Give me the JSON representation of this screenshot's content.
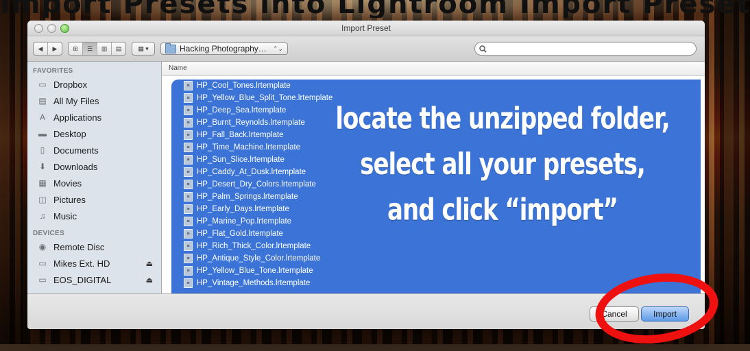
{
  "banner_text": "Import Presets into Lightroom Import Preset",
  "window": {
    "title": "Import Preset"
  },
  "toolbar": {
    "back_label": "◀",
    "forward_label": "▶",
    "view_icons": "⊞",
    "view_list": "☰",
    "view_columns": "▥",
    "view_coverflow": "▤",
    "arrange_label": "▦ ▾",
    "location": "Hacking Photography…",
    "search_placeholder": "",
    "search_icon": "magnifier"
  },
  "sidebar": {
    "favorites_header": "FAVORITES",
    "favorites": [
      {
        "label": "Dropbox",
        "icon": "folder-icon"
      },
      {
        "label": "All My Files",
        "icon": "all-files-icon"
      },
      {
        "label": "Applications",
        "icon": "applications-icon"
      },
      {
        "label": "Desktop",
        "icon": "desktop-icon"
      },
      {
        "label": "Documents",
        "icon": "documents-icon"
      },
      {
        "label": "Downloads",
        "icon": "downloads-icon"
      },
      {
        "label": "Movies",
        "icon": "movies-icon"
      },
      {
        "label": "Pictures",
        "icon": "pictures-icon"
      },
      {
        "label": "Music",
        "icon": "music-icon"
      }
    ],
    "devices_header": "DEVICES",
    "devices": [
      {
        "label": "Remote Disc",
        "icon": "disc-icon",
        "eject": ""
      },
      {
        "label": "Mikes Ext. HD",
        "icon": "drive-icon",
        "eject": "⏏"
      },
      {
        "label": "EOS_DIGITAL",
        "icon": "drive-icon",
        "eject": "⏏"
      }
    ]
  },
  "main": {
    "column_header": "Name",
    "files": [
      "HP_Cool_Tones.lrtemplate",
      "HP_Yellow_Blue_Split_Tone.lrtemplate",
      "HP_Deep_Sea.lrtemplate",
      "HP_Burnt_Reynolds.lrtemplate",
      "HP_Fall_Back.lrtemplate",
      "HP_Time_Machine.lrtemplate",
      "HP_Sun_Slice.lrtemplate",
      "HP_Caddy_At_Dusk.lrtemplate",
      "HP_Desert_Dry_Colors.lrtemplate",
      "HP_Palm_Springs.lrtemplate",
      "HP_Early_Days.lrtemplate",
      "HP_Marine_Pop.lrtemplate",
      "HP_Flat_Gold.lrtemplate",
      "HP_Rich_Thick_Color.lrtemplate",
      "HP_Antique_Style_Color.lrtemplate",
      "HP_Yellow_Blue_Tone.lrtemplate",
      "HP_Vintage_Methods.lrtemplate"
    ],
    "selection_color": "#3b74d6"
  },
  "overlay": {
    "line1": "locate the unzipped folder,",
    "line2": "select all your presets,",
    "line3": "and click “import”"
  },
  "footer": {
    "cancel_label": "Cancel",
    "import_label": "Import"
  },
  "annotation": {
    "circle_color": "#ef1010"
  }
}
